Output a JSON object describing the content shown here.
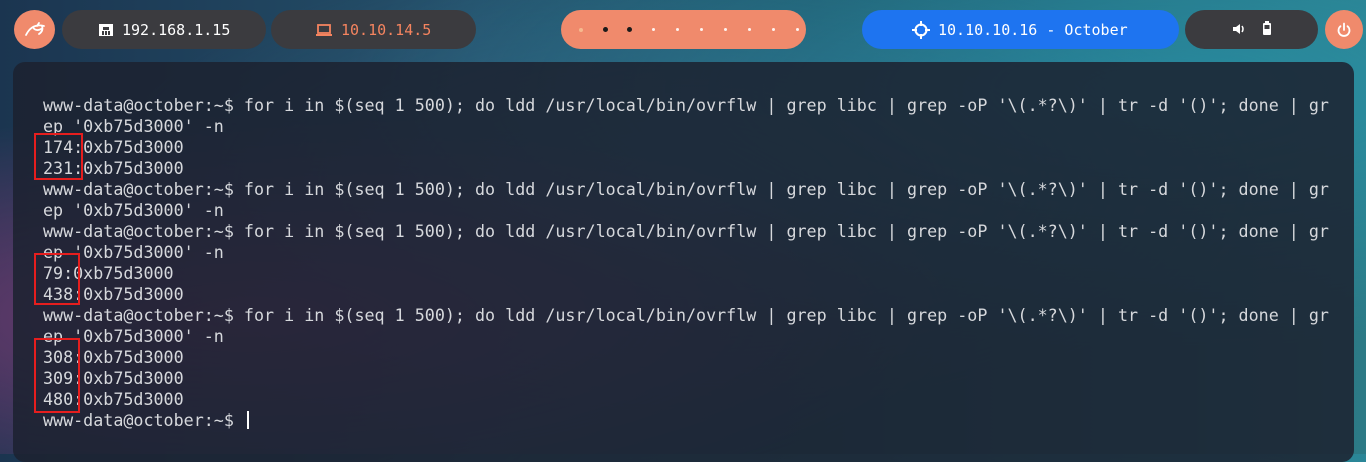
{
  "topbar": {
    "local_ip": "192.168.1.15",
    "vpn_ip": "10.10.14.5",
    "target": "10.10.10.16 - October",
    "workspaces": [
      {
        "state": "dim"
      },
      {
        "state": "active"
      },
      {
        "state": "active"
      },
      {
        "state": "empty"
      },
      {
        "state": "empty"
      },
      {
        "state": "empty"
      },
      {
        "state": "empty"
      },
      {
        "state": "empty"
      },
      {
        "state": "empty"
      },
      {
        "state": "empty"
      }
    ],
    "icons": {
      "menu": "kali-dragon-icon",
      "local": "ethernet-icon",
      "vpn": "laptop-icon",
      "target": "crosshair-icon",
      "volume": "volume-icon",
      "battery": "battery-icon",
      "power": "power-icon"
    },
    "colors": {
      "accent": "#f08a6c",
      "pill_bg": "#3b3b3f",
      "vpn_text": "#f5845f",
      "target_bg": "#1e74f0"
    }
  },
  "terminal": {
    "lines": [
      "www-data@october:~$ for i in $(seq 1 500); do ldd /usr/local/bin/ovrflw | grep libc | grep -oP '\\(.*?\\)' | tr -d '()'; done | gr",
      "ep '0xb75d3000' -n",
      "174:0xb75d3000",
      "231:0xb75d3000",
      "www-data@october:~$ for i in $(seq 1 500); do ldd /usr/local/bin/ovrflw | grep libc | grep -oP '\\(.*?\\)' | tr -d '()'; done | gr",
      "ep '0xb75d3000' -n",
      "www-data@october:~$ for i in $(seq 1 500); do ldd /usr/local/bin/ovrflw | grep libc | grep -oP '\\(.*?\\)' | tr -d '()'; done | gr",
      "ep '0xb75d3000' -n",
      "79:0xb75d3000",
      "438:0xb75d3000",
      "www-data@october:~$ for i in $(seq 1 500); do ldd /usr/local/bin/ovrflw | grep libc | grep -oP '\\(.*?\\)' | tr -d '()'; done | gr",
      "ep '0xb75d3000' -n",
      "308:0xb75d3000",
      "309:0xb75d3000",
      "480:0xb75d3000",
      "www-data@october:~$ "
    ],
    "highlight_color": "#e61e1e",
    "text_color": "#d6d8dc"
  }
}
